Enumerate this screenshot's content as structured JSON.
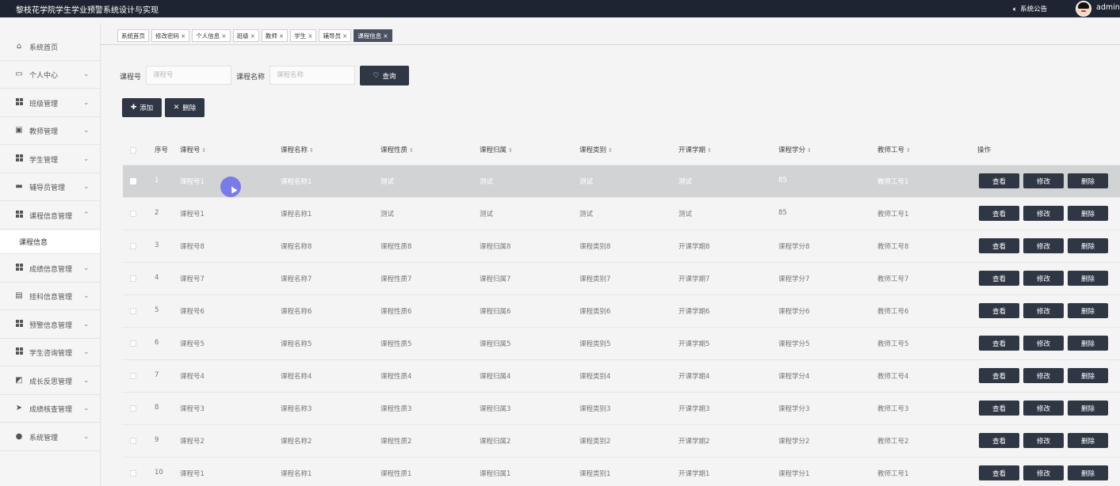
{
  "header": {
    "title": "黎枝花学院学生学业预警系统设计与实现",
    "notice": "系统公告",
    "user": "admin"
  },
  "sidebar": {
    "items": [
      {
        "label": "系统首页",
        "icon": "home-icon",
        "chevron": false
      },
      {
        "label": "个人中心",
        "icon": "id-card-icon",
        "chevron": true
      },
      {
        "label": "班级管理",
        "icon": "grid-icon",
        "chevron": true
      },
      {
        "label": "教师管理",
        "icon": "clipboard-icon",
        "chevron": true
      },
      {
        "label": "学生管理",
        "icon": "grid-icon",
        "chevron": true
      },
      {
        "label": "辅导员管理",
        "icon": "monitor-icon",
        "chevron": true
      },
      {
        "label": "课程信息管理",
        "icon": "grid-icon",
        "chevron": true,
        "expanded": true
      },
      {
        "label": "成绩信息管理",
        "icon": "grid-icon",
        "chevron": true
      },
      {
        "label": "挂科信息管理",
        "icon": "printer-icon",
        "chevron": true
      },
      {
        "label": "预警信息管理",
        "icon": "grid-icon",
        "chevron": true
      },
      {
        "label": "学生咨询管理",
        "icon": "grid-icon",
        "chevron": true
      },
      {
        "label": "成长反思管理",
        "icon": "chart-icon",
        "chevron": true
      },
      {
        "label": "成绩核查管理",
        "icon": "send-icon",
        "chevron": true
      },
      {
        "label": "系统管理",
        "icon": "user-icon",
        "chevron": true
      }
    ],
    "sub_item": "课程信息"
  },
  "tabs": [
    {
      "label": "系统首页",
      "closable": false
    },
    {
      "label": "修改密码",
      "closable": true
    },
    {
      "label": "个人信息",
      "closable": true
    },
    {
      "label": "班级",
      "closable": true
    },
    {
      "label": "教师",
      "closable": true
    },
    {
      "label": "学生",
      "closable": true
    },
    {
      "label": "辅导员",
      "closable": true
    },
    {
      "label": "课程信息",
      "closable": true,
      "active": true
    }
  ],
  "search": {
    "course_no_label": "课程号",
    "course_no_placeholder": "课程号",
    "course_name_label": "课程名称",
    "course_name_placeholder": "课程名称",
    "query_button": "查询"
  },
  "toolbar": {
    "add_label": "添加",
    "delete_label": "删除"
  },
  "table": {
    "columns": [
      "序号",
      "课程号",
      "课程名称",
      "课程性质",
      "课程归属",
      "课程类别",
      "开课学期",
      "课程学分",
      "教师工号",
      "操作"
    ],
    "actions": [
      "查看",
      "修改",
      "删除"
    ],
    "rows": [
      [
        "1",
        "课程号1",
        "课程名称1",
        "测试",
        "测试",
        "测试",
        "测试",
        "85",
        "教师工号1"
      ],
      [
        "2",
        "课程号1",
        "课程名称1",
        "测试",
        "测试",
        "测试",
        "测试",
        "85",
        "教师工号1"
      ],
      [
        "3",
        "课程号8",
        "课程名称8",
        "课程性质8",
        "课程归属8",
        "课程类别8",
        "开课学期8",
        "课程学分8",
        "教师工号8"
      ],
      [
        "4",
        "课程号7",
        "课程名称7",
        "课程性质7",
        "课程归属7",
        "课程类别7",
        "开课学期7",
        "课程学分7",
        "教师工号7"
      ],
      [
        "5",
        "课程号6",
        "课程名称6",
        "课程性质6",
        "课程归属6",
        "课程类别6",
        "开课学期6",
        "课程学分6",
        "教师工号6"
      ],
      [
        "6",
        "课程号5",
        "课程名称5",
        "课程性质5",
        "课程归属5",
        "课程类别5",
        "开课学期5",
        "课程学分5",
        "教师工号5"
      ],
      [
        "7",
        "课程号4",
        "课程名称4",
        "课程性质4",
        "课程归属4",
        "课程类别4",
        "开课学期4",
        "课程学分4",
        "教师工号4"
      ],
      [
        "8",
        "课程号3",
        "课程名称3",
        "课程性质3",
        "课程归属3",
        "课程类别3",
        "开课学期3",
        "课程学分3",
        "教师工号3"
      ],
      [
        "9",
        "课程号2",
        "课程名称2",
        "课程性质2",
        "课程归属2",
        "课程类别2",
        "开课学期2",
        "课程学分2",
        "教师工号2"
      ],
      [
        "10",
        "课程号1",
        "课程名称1",
        "课程性质1",
        "课程归属1",
        "课程类别1",
        "开课学期1",
        "课程学分1",
        "教师工号1"
      ]
    ]
  }
}
